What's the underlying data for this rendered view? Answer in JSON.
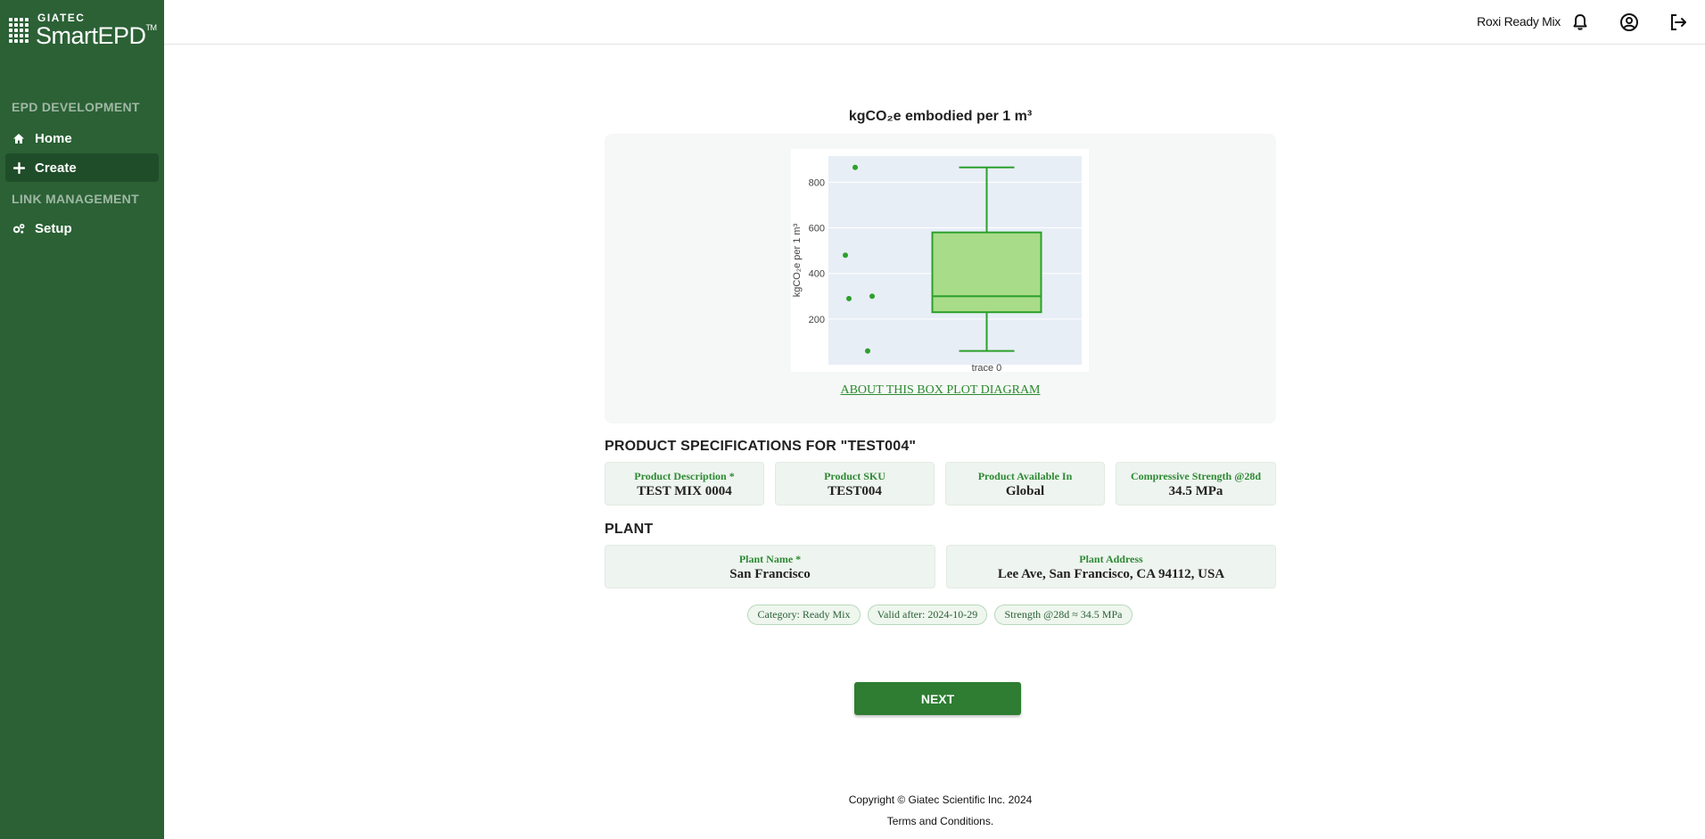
{
  "brand": {
    "top": "GIATEC",
    "name": "SmartEPD",
    "tm": "TM"
  },
  "sidebar": {
    "sections": [
      {
        "label": "EPD DEVELOPMENT"
      },
      {
        "label": "LINK MANAGEMENT"
      }
    ],
    "items": [
      {
        "label": "Home",
        "icon": "home-icon"
      },
      {
        "label": "Create",
        "icon": "plus-icon",
        "active": true
      },
      {
        "label": "Setup",
        "icon": "gears-icon"
      }
    ]
  },
  "topbar": {
    "user": "Roxi Ready Mix",
    "icons": [
      "bell-icon",
      "user-circle-icon",
      "logout-icon"
    ]
  },
  "chart": {
    "title": "kgCO₂e embodied per 1 m³",
    "about_link": "ABOUT THIS BOX PLOT DIAGRAM"
  },
  "chart_data": {
    "type": "box",
    "ylabel": "kgCO₂e per 1 m³",
    "xlabel": "",
    "categories": [
      "trace 0"
    ],
    "yticks": [
      200,
      400,
      600,
      800
    ],
    "ylim": [
      0,
      915
    ],
    "grid": true,
    "box": {
      "lowerfence": 60,
      "q1": 230,
      "median": 300,
      "q3": 580,
      "upperfence": 865
    },
    "points": [
      865,
      480,
      290,
      300,
      60
    ],
    "color": "#2ca02c",
    "fill": "#a9dc89"
  },
  "product": {
    "heading": "PRODUCT SPECIFICATIONS FOR \"TEST004\"",
    "fields": [
      {
        "label": "Product Description *",
        "value": "TEST MIX 0004"
      },
      {
        "label": "Product SKU",
        "value": "TEST004"
      },
      {
        "label": "Product Available In",
        "value": "Global"
      },
      {
        "label": "Compressive Strength @28d",
        "value": "34.5 MPa"
      }
    ]
  },
  "plant": {
    "heading": "PLANT",
    "fields": [
      {
        "label": "Plant Name *",
        "value": "San Francisco"
      },
      {
        "label": "Plant Address",
        "value": "Lee Ave, San Francisco, CA 94112, USA"
      }
    ]
  },
  "chips": [
    "Category: Ready Mix",
    "Valid after: 2024-10-29",
    "Strength @28d ≈ 34.5 MPa"
  ],
  "actions": {
    "next_label": "NEXT"
  },
  "footer": {
    "copyright": "Copyright © Giatec Scientific Inc. 2024",
    "terms": "Terms and Conditions."
  },
  "colors": {
    "sidebar": "#2b6135",
    "accent": "#2e7d32",
    "active": "#1f4d29"
  }
}
